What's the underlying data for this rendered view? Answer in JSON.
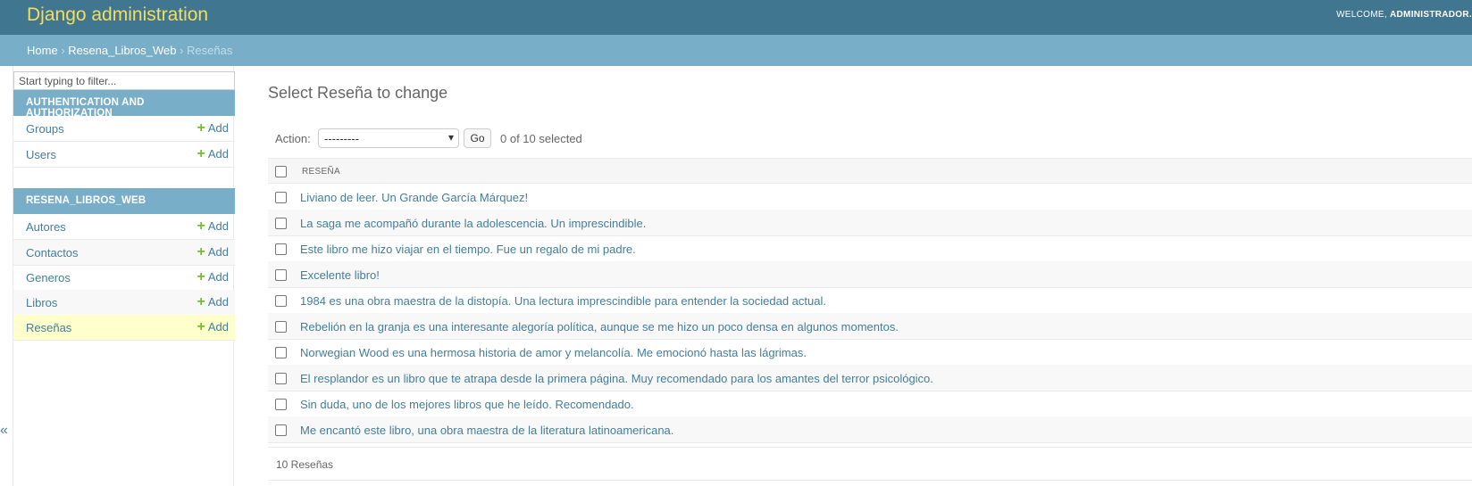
{
  "header": {
    "site_name": "Django administration",
    "welcome": "WELCOME,",
    "user": "ADMINISTRADOR."
  },
  "breadcrumbs": {
    "home": "Home",
    "sep": "›",
    "app": "Resena_Libros_Web",
    "current": "Reseñas"
  },
  "sidebar": {
    "filter_placeholder": "Start typing to filter...",
    "apps": [
      {
        "caption": "AUTHENTICATION AND AUTHORIZATION",
        "models": [
          {
            "name": "Groups",
            "add": "Add"
          },
          {
            "name": "Users",
            "add": "Add"
          }
        ]
      },
      {
        "caption": "RESENA_LIBROS_WEB",
        "models": [
          {
            "name": "Autores",
            "add": "Add"
          },
          {
            "name": "Contactos",
            "add": "Add"
          },
          {
            "name": "Generos",
            "add": "Add"
          },
          {
            "name": "Libros",
            "add": "Add"
          },
          {
            "name": "Reseñas",
            "add": "Add"
          }
        ]
      }
    ],
    "toggle": "«"
  },
  "content": {
    "title": "Select Reseña to change",
    "action_label": "Action:",
    "action_value": "---------",
    "go": "Go",
    "counter": "0 of 10 selected",
    "column_header": "RESEÑA",
    "rows": [
      "Liviano de leer. Un Grande García Márquez!",
      "La saga me acompañó durante la adolescencia. Un imprescindible.",
      "Este libro me hizo viajar en el tiempo. Fue un regalo de mi padre.",
      "Excelente libro!",
      "1984 es una obra maestra de la distopía. Una lectura imprescindible para entender la sociedad actual.",
      "Rebelión en la granja es una interesante alegoría política, aunque se me hizo un poco densa en algunos momentos.",
      "Norwegian Wood es una hermosa historia de amor y melancolía. Me emocionó hasta las lágrimas.",
      "El resplandor es un libro que te atrapa desde la primera página. Muy recomendado para los amantes del terror psicológico.",
      "Sin duda, uno de los mejores libros que he leído. Recomendado.",
      "Me encantó este libro, una obra maestra de la literatura latinoamericana."
    ],
    "paginator": "10 Reseñas"
  },
  "colors": {
    "header_bg": "#417690",
    "breadcrumb_bg": "#79aec8",
    "link": "#447e9b",
    "add_plus": "#70bf2b",
    "current_row": "#ffffcc"
  }
}
